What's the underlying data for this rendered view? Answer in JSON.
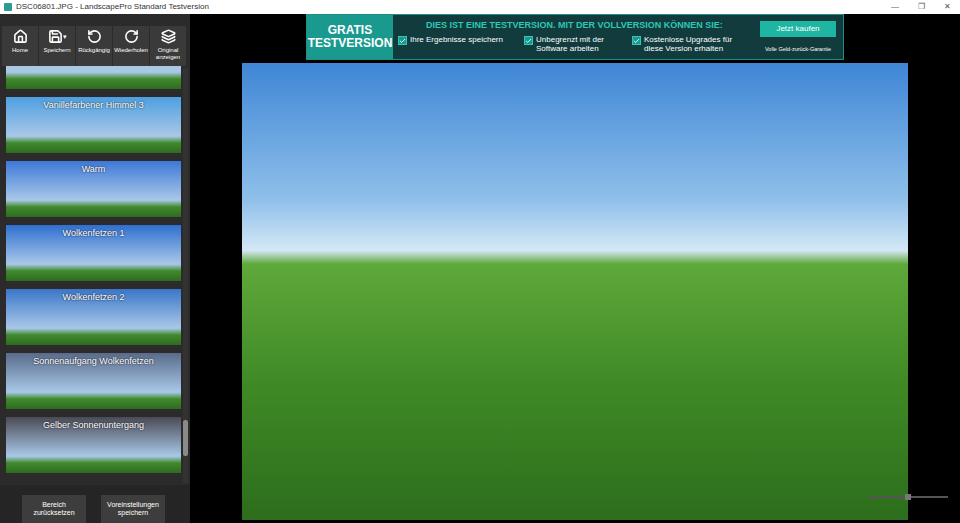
{
  "window": {
    "title": "DSC06801.JPG - LandscapePro Standard Testversion",
    "controls": [
      "—",
      "❐",
      "✕"
    ]
  },
  "toolbar": [
    {
      "label": "Home",
      "icon": "home"
    },
    {
      "label": "Speichern",
      "icon": "save",
      "dropdown": "▾"
    },
    {
      "label": "Rückgängig",
      "icon": "undo"
    },
    {
      "label": "Wiederholen",
      "icon": "redo"
    },
    {
      "label": "Original anzeigen",
      "icon": "layers"
    }
  ],
  "presets": [
    {
      "label": "",
      "color": "#b7c0c4"
    },
    {
      "label": "Vanillefarbener Himmel 3",
      "color": "#4d9fe0"
    },
    {
      "label": "Warm",
      "color": "#3d78d8"
    },
    {
      "label": "Wolkenfetzen 1",
      "color": "#2f6fd0"
    },
    {
      "label": "Wolkenfetzen 2",
      "color": "#3a76c8"
    },
    {
      "label": "Sonnenaufgang Wolkenfetzen",
      "color": "#5a6b8a"
    },
    {
      "label": "Gelber Sonnenuntergang",
      "color": "#4a4a55"
    }
  ],
  "scrollbar": {
    "level": 0.93
  },
  "sidebar_buttons": [
    "Bereich zurücksetzen",
    "Voreinstellungen speichern"
  ],
  "banner": {
    "badge": [
      "GRATIS",
      "TESTVERSION"
    ],
    "heading": "DIES IST EINE TESTVERSION. MIT DER VOLLVERSION KÖNNEN SIE:",
    "features": [
      {
        "label": "Ihre Ergebnisse speichern",
        "checked": true
      },
      {
        "label": "Unbegrenzt mit der Software arbeiten",
        "checked": true
      },
      {
        "label": "Kostenlose Upgrades für diese Version erhalten",
        "checked": true
      }
    ],
    "button": "Jetzt kaufen",
    "guarantee": "Volle Geld-zurück-Garantie"
  },
  "zoom": {
    "level": 0.5
  }
}
